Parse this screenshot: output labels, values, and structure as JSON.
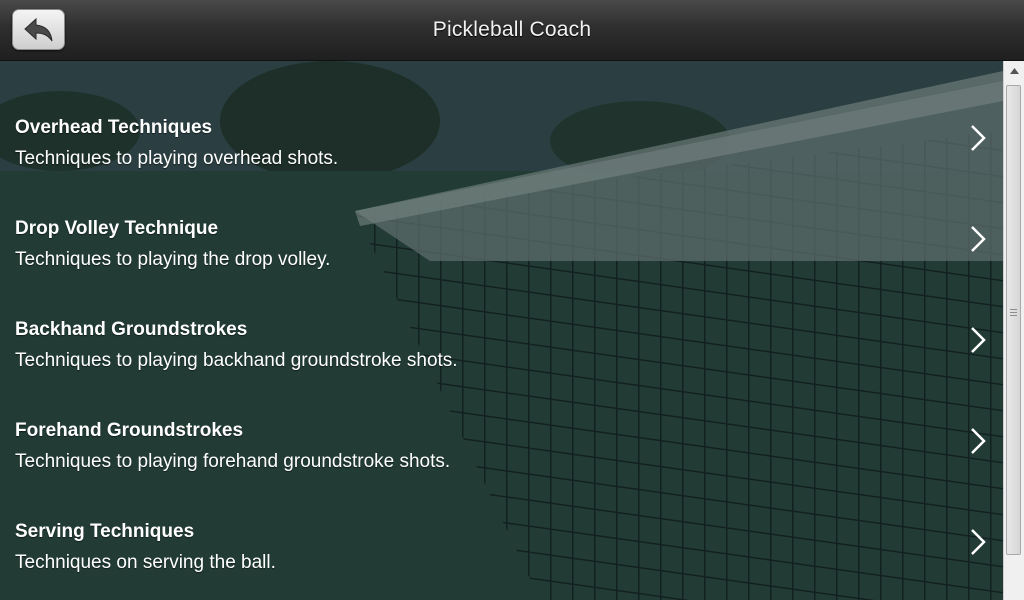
{
  "header": {
    "title": "Pickleball Coach",
    "back_icon": "back-arrow-icon"
  },
  "list": {
    "items": [
      {
        "title": "Overhead Techniques",
        "description": "Techniques to playing overhead shots."
      },
      {
        "title": "Drop Volley Technique",
        "description": "Techniques to playing the drop volley."
      },
      {
        "title": "Backhand Groundstrokes",
        "description": "Techniques to playing backhand groundstroke shots."
      },
      {
        "title": "Forehand Groundstrokes",
        "description": "Techniques to playing forehand groundstroke shots."
      },
      {
        "title": "Serving Techniques",
        "description": "Techniques on serving the ball."
      }
    ],
    "chevron_icon": "chevron-right-icon"
  },
  "colors": {
    "header_bg": "#2f2f2f",
    "text": "#ffffff",
    "overlay": "#1b2a2b"
  }
}
